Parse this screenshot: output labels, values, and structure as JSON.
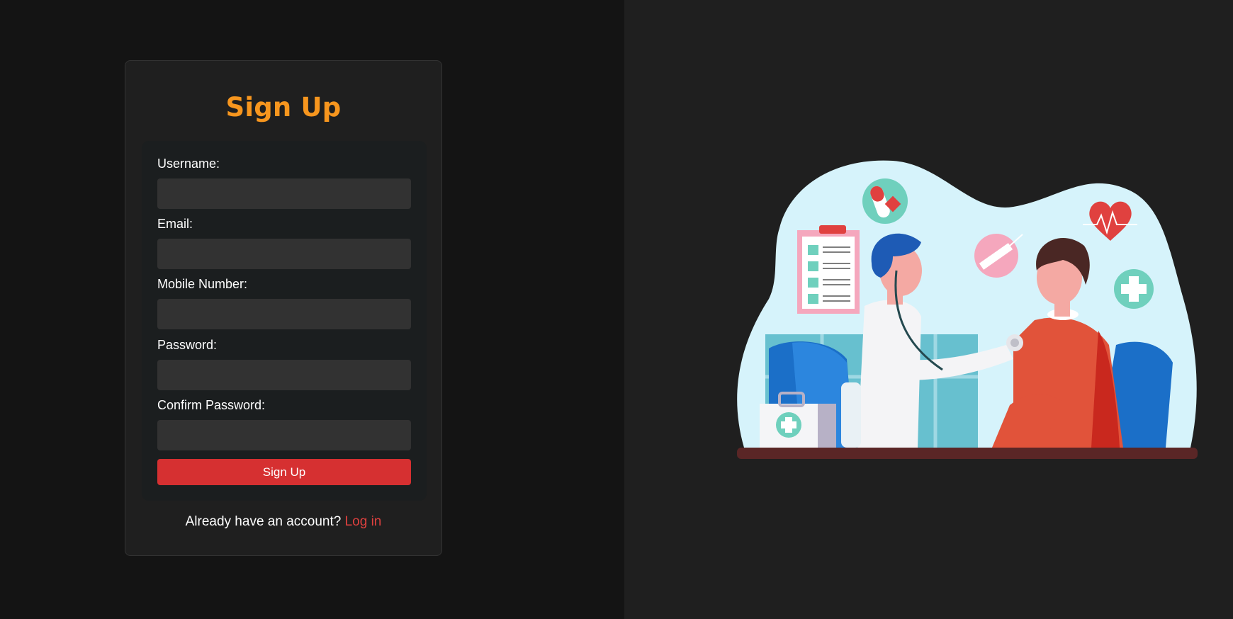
{
  "signup": {
    "title": "Sign Up",
    "fields": [
      {
        "label": "Username:",
        "value": "",
        "type": "text"
      },
      {
        "label": "Email:",
        "value": "",
        "type": "email"
      },
      {
        "label": "Mobile Number:",
        "value": "",
        "type": "tel"
      },
      {
        "label": "Password:",
        "value": "",
        "type": "password"
      },
      {
        "label": "Confirm Password:",
        "value": "",
        "type": "password"
      }
    ],
    "submit_label": "Sign Up",
    "footer_text": "Already have an account?",
    "login_link": "Log in"
  },
  "colors": {
    "accent_orange": "#f7961e",
    "button_red": "#d63031",
    "link_red": "#e0413f",
    "card_bg": "#1f1f1f",
    "input_bg": "#323232"
  },
  "illustration": {
    "subject": "doctor examining patient with stethoscope",
    "icons": [
      "pill-icon",
      "clipboard-checklist-icon",
      "syringe-icon",
      "heart-pulse-icon",
      "medical-cross-icon",
      "first-aid-kit-icon"
    ]
  }
}
